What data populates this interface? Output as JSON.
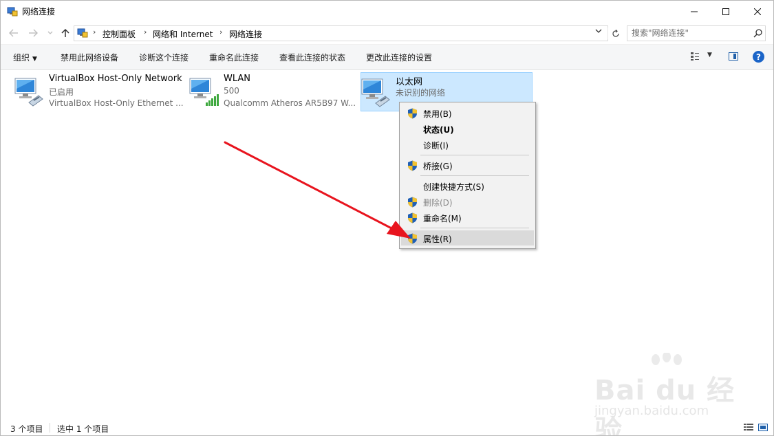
{
  "window": {
    "title": "网络连接"
  },
  "address": {
    "crumbs": [
      "控制面板",
      "网络和 Internet",
      "网络连接"
    ]
  },
  "search": {
    "placeholder": "搜索\"网络连接\""
  },
  "toolbar": {
    "organize": "组织",
    "disable_device": "禁用此网络设备",
    "diagnose": "诊断这个连接",
    "rename": "重命名此连接",
    "view_status": "查看此连接的状态",
    "change_settings": "更改此连接的设置",
    "help": "?"
  },
  "connections": [
    {
      "name": "VirtualBox Host-Only Network",
      "status": "已启用",
      "device": "VirtualBox Host-Only Ethernet ...",
      "icon": "ethernet-icon"
    },
    {
      "name": "WLAN",
      "status": "500",
      "device": "Qualcomm Atheros AR5B97 W...",
      "icon": "wifi-signal-icon"
    },
    {
      "name": "以太网",
      "status": "未识别的网络",
      "device": "",
      "icon": "ethernet-icon",
      "selected": true
    }
  ],
  "context_menu": {
    "items": [
      {
        "label": "禁用(B)",
        "shield": true
      },
      {
        "label": "状态(U)",
        "bold": true
      },
      {
        "label": "诊断(I)"
      },
      {
        "label": "桥接(G)",
        "shield": true
      },
      {
        "label": "创建快捷方式(S)"
      },
      {
        "label": "删除(D)",
        "shield": true,
        "disabled": true
      },
      {
        "label": "重命名(M)",
        "shield": true
      },
      {
        "label": "属性(R)",
        "shield": true,
        "hover": true
      }
    ]
  },
  "statusbar": {
    "item_count": "3 个项目",
    "selected_count": "选中 1 个项目"
  },
  "watermark": {
    "brand": "Bai du 经验",
    "url": "jingyan.baidu.com"
  },
  "colors": {
    "selection": "#cce8ff",
    "accent": "#1a64c8",
    "arrow": "#e8141e"
  }
}
